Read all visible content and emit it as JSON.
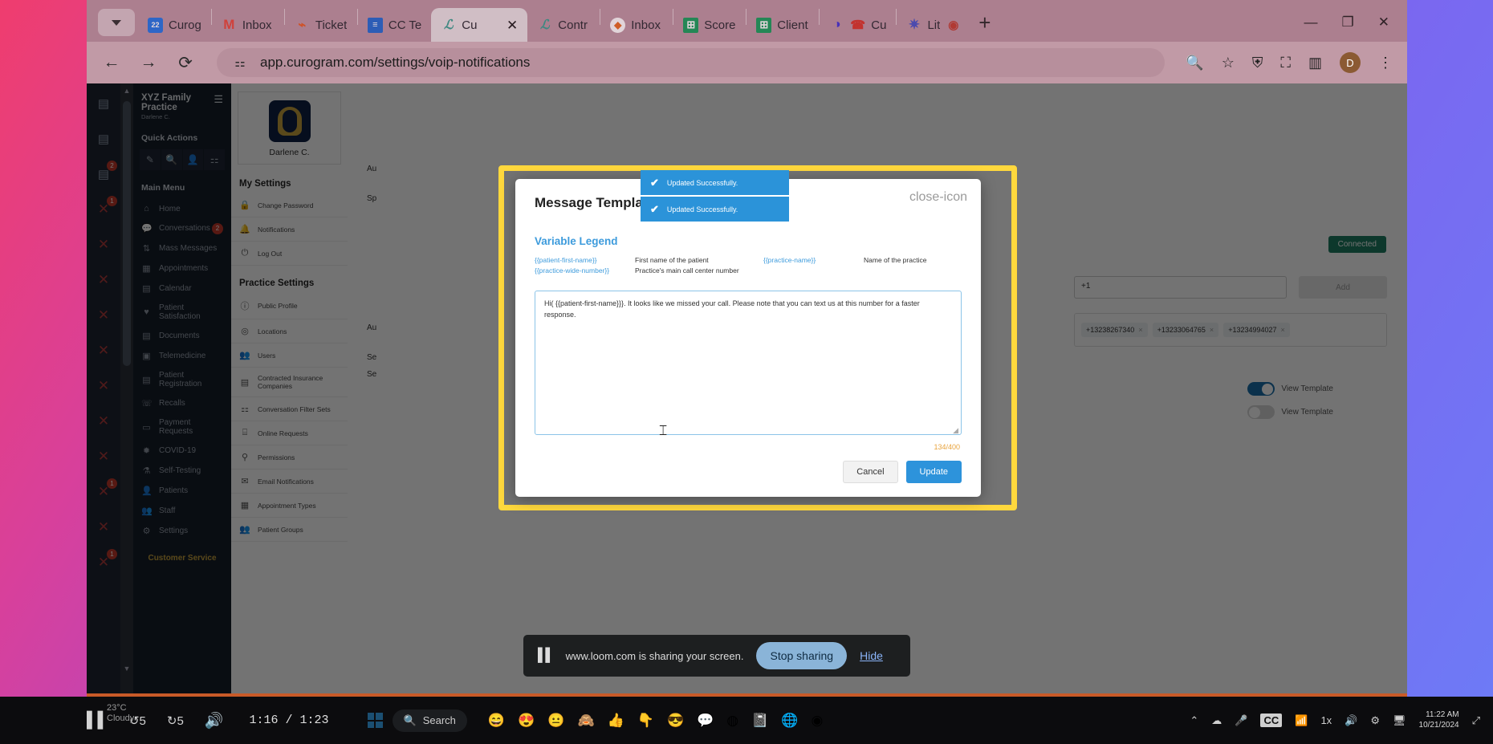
{
  "browser": {
    "tabs": [
      {
        "label": "Curog",
        "icon": "calendar-icon",
        "active": false
      },
      {
        "label": "Inbox",
        "icon": "gmail-icon",
        "active": false
      },
      {
        "label": "Ticket",
        "icon": "tickets-icon",
        "active": false
      },
      {
        "label": "CC Te",
        "icon": "doc-icon",
        "active": false
      },
      {
        "label": "Cu",
        "icon": "curogram-icon",
        "active": true
      },
      {
        "label": "Contr",
        "icon": "curogram-icon",
        "active": false
      },
      {
        "label": "Inbox",
        "icon": "inbox-icon",
        "active": false
      },
      {
        "label": "Score",
        "icon": "sheets-icon",
        "active": false
      },
      {
        "label": "Client",
        "icon": "sheets-icon",
        "active": false
      },
      {
        "label": "Cu",
        "icon": "phone-icon",
        "active": false
      },
      {
        "label": "Lit",
        "icon": "star-icon",
        "active": false
      }
    ],
    "new_tab_label": "+",
    "url": "app.curogram.com/settings/voip-notifications",
    "window_controls": {
      "minimize": "—",
      "maximize": "❐",
      "close": "✕"
    },
    "profile_initial": "D",
    "back_icon": "back-arrow-icon",
    "forward_icon": "forward-arrow-icon",
    "reload_icon": "reload-icon"
  },
  "sidebar": {
    "practice_name": "XYZ Family Practice",
    "practice_user": "Darlene C.",
    "quick_actions_label": "Quick Actions",
    "quick_action_icons": [
      "compose-icon",
      "search-icon",
      "add-patient-icon",
      "filter-icon"
    ],
    "main_menu_label": "Main Menu",
    "items": [
      {
        "label": "Home",
        "icon": "home-icon",
        "badge": ""
      },
      {
        "label": "Conversations",
        "icon": "chat-icon",
        "badge": "2"
      },
      {
        "label": "Mass Messages",
        "icon": "broadcast-icon",
        "badge": ""
      },
      {
        "label": "Appointments",
        "icon": "appointments-icon",
        "badge": ""
      },
      {
        "label": "Calendar",
        "icon": "calendar-icon",
        "badge": ""
      },
      {
        "label": "Patient Satisfaction",
        "icon": "heart-icon",
        "badge": ""
      },
      {
        "label": "Documents",
        "icon": "documents-icon",
        "badge": ""
      },
      {
        "label": "Telemedicine",
        "icon": "video-icon",
        "badge": ""
      },
      {
        "label": "Patient Registration",
        "icon": "registration-icon",
        "badge": ""
      },
      {
        "label": "Recalls",
        "icon": "recall-phone-icon",
        "badge": ""
      },
      {
        "label": "Payment Requests",
        "icon": "card-icon",
        "badge": ""
      },
      {
        "label": "COVID-19",
        "icon": "virus-icon",
        "badge": ""
      },
      {
        "label": "Self-Testing",
        "icon": "test-icon",
        "badge": ""
      },
      {
        "label": "Patients",
        "icon": "person-icon",
        "badge": ""
      },
      {
        "label": "Staff",
        "icon": "people-icon",
        "badge": ""
      },
      {
        "label": "Settings",
        "icon": "gear-icon",
        "badge": ""
      }
    ],
    "customer_service": "Customer Service"
  },
  "settings_panel": {
    "avatar_name": "Darlene C.",
    "my_settings_label": "My Settings",
    "my_settings": [
      {
        "label": "Change Password",
        "icon": "lock-icon"
      },
      {
        "label": "Notifications",
        "icon": "bell-icon"
      },
      {
        "label": "Log Out",
        "icon": "power-icon"
      }
    ],
    "practice_settings_label": "Practice Settings",
    "practice_settings": [
      {
        "label": "Public Profile",
        "icon": "info-icon"
      },
      {
        "label": "Locations",
        "icon": "pin-icon"
      },
      {
        "label": "Users",
        "icon": "users-icon"
      },
      {
        "label": "Contracted Insurance Companies",
        "icon": "id-card-icon"
      },
      {
        "label": "Conversation Filter Sets",
        "icon": "sliders-icon"
      },
      {
        "label": "Online Requests",
        "icon": "online-request-icon"
      },
      {
        "label": "Permissions",
        "icon": "permission-icon"
      },
      {
        "label": "Email Notifications",
        "icon": "email-user-icon"
      },
      {
        "label": "Appointment Types",
        "icon": "calendar-types-icon"
      },
      {
        "label": "Patient Groups",
        "icon": "group-icon"
      }
    ]
  },
  "main": {
    "status_badge": "Connected",
    "phone_input_value": "+1",
    "add_button": "Add",
    "phone_chips": [
      "+13238267340",
      "+13233064765",
      "+13234994027"
    ],
    "toggles": [
      {
        "label": "View Template",
        "state": "on"
      },
      {
        "label": "View Template",
        "state": "off"
      }
    ],
    "row_labels": [
      "Au",
      "Sp",
      "Au",
      "Se",
      "Se"
    ]
  },
  "modal": {
    "title": "Message Template",
    "close_icon": "close-icon",
    "variable_legend_title": "Variable Legend",
    "legend": [
      {
        "var": "{{patient-first-name}}",
        "desc": "First name of the patient"
      },
      {
        "var": "{{practice-name}}",
        "desc": "Name of the practice"
      },
      {
        "var": "{{practice-wide-number}}",
        "desc": "Practice's main call center number"
      }
    ],
    "textarea_value": "Hi( {{patient-first-name}}}. It looks like we missed your call. Please note that you can text us at this number for a faster response.",
    "char_count": "134/400",
    "cancel_label": "Cancel",
    "update_label": "Update",
    "accent_color": "#2d93db",
    "char_count_color": "#e8a33d"
  },
  "toasts": [
    {
      "message": "Updated Successfully.",
      "icon": "check-icon"
    },
    {
      "message": "Updated Successfully.",
      "icon": "check-icon"
    }
  ],
  "share_bar": {
    "text": "www.loom.com is sharing your screen.",
    "stop_label": "Stop sharing",
    "hide_label": "Hide",
    "pause_icon": "pause-icon"
  },
  "player_bar": {
    "pause_icon": "pause-icon",
    "rewind_label": "5",
    "forward_label": "5",
    "volume_icon": "volume-icon",
    "current_time": "1:16",
    "separator": "/",
    "total_time": "1:23",
    "weather_temp": "23°C",
    "weather_desc": "Cloudy",
    "search_label": "Search",
    "taskbar_icons": [
      "emoji-icon",
      "emoji-heart-icon",
      "emoji-neutral-icon",
      "emoji-monkey-icon",
      "thumbs-up-icon",
      "pointer-icon",
      "reaction-icon",
      "comment-icon",
      "browser-icon",
      "notes-icon",
      "globe-icon",
      "chrome-icon"
    ],
    "tray": {
      "chevron": "⌃",
      "cloud_icon": "cloud-icon",
      "mic_icon": "mic-icon",
      "cc_label": "CC",
      "wifi_icon": "wifi-icon",
      "speed_label": "1x",
      "volume_icon": "volume-icon",
      "gear_icon": "gear-icon",
      "screen_icon": "screen-icon",
      "expand_icon": "expand-icon"
    },
    "clock_time": "11:22 AM",
    "clock_date": "10/21/2024"
  }
}
